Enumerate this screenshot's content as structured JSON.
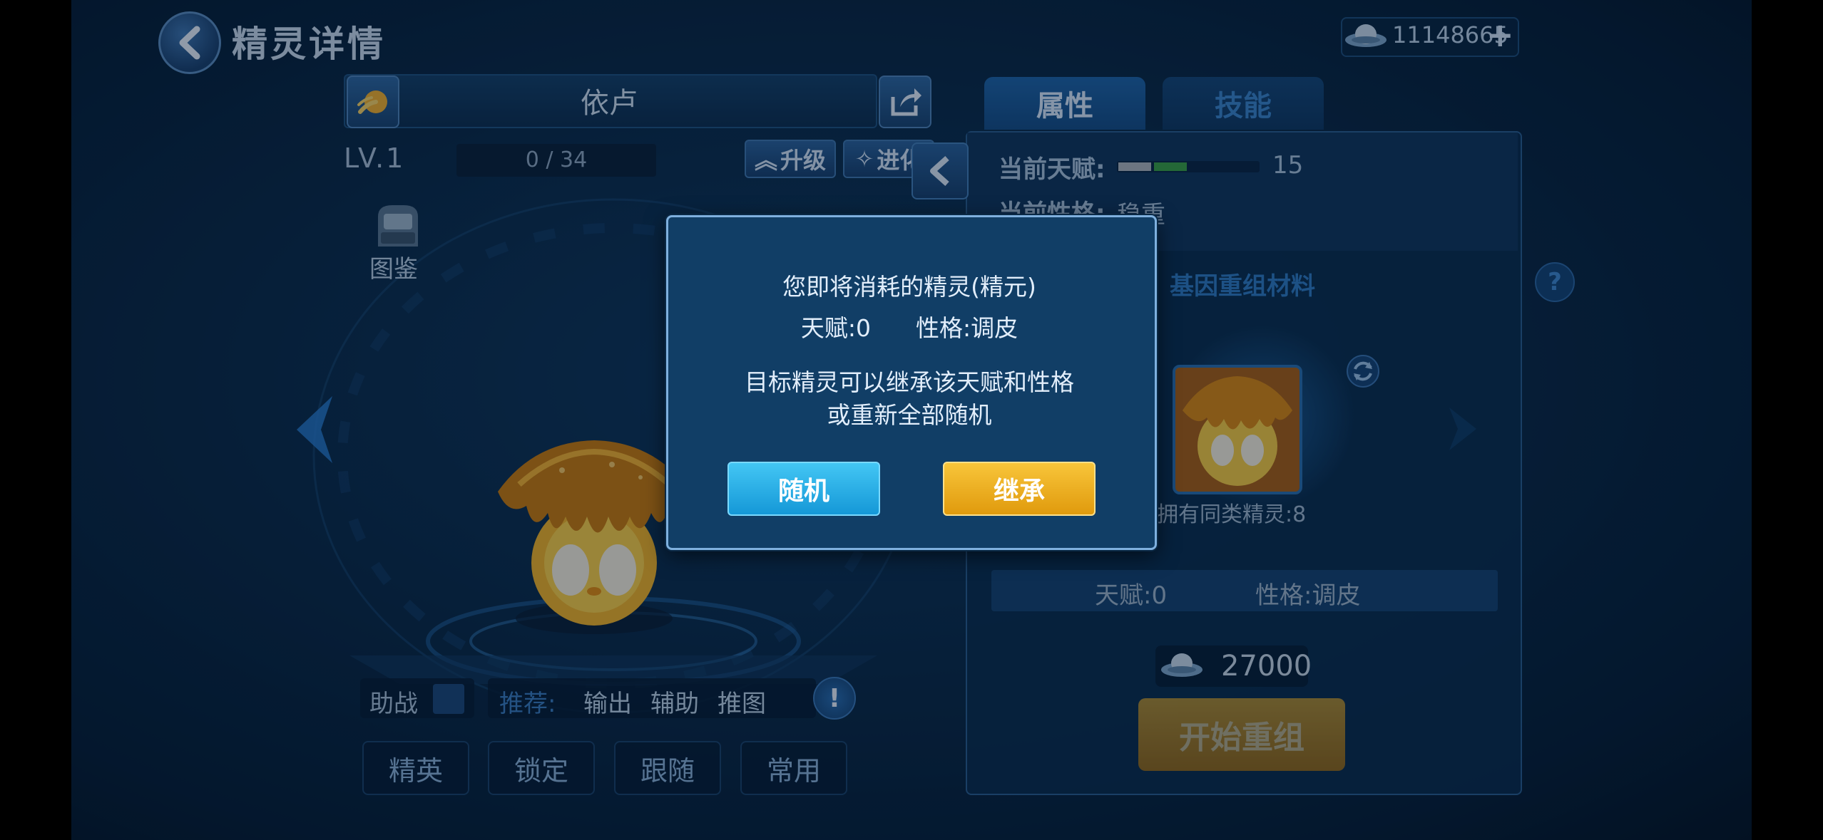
{
  "header": {
    "title": "精灵详情",
    "currency_value": "11148665",
    "currency_icon": "ufo-coin-icon",
    "plus_icon": "plus-icon"
  },
  "pet": {
    "name": "依卢",
    "level_label": "LV.1",
    "exp_text": "0 / 34",
    "upgrade_label": "升级",
    "evolve_label": "进化",
    "codex_label": "图鉴"
  },
  "left_bottom": {
    "assist_label": "助战",
    "recommend_label": "推荐:",
    "recommend_tags": [
      "输出",
      "辅助",
      "推图"
    ],
    "buttons": [
      "精英",
      "锁定",
      "跟随",
      "常用"
    ]
  },
  "tabs": {
    "attributes": "属性",
    "skills": "技能"
  },
  "right_panel": {
    "talent_label": "当前天赋:",
    "talent_value": "15",
    "nature_label": "当前性格:",
    "nature_value": "稳重",
    "gene_title": "基因重组材料",
    "help_icon_text": "?",
    "own_same_text": "拥有同类精灵:8",
    "stat_talent": "天赋:0",
    "stat_nature": "性格:调皮",
    "cost_value": "27000",
    "start_button": "开始重组"
  },
  "dialog": {
    "line1": "您即将消耗的精灵(精元)",
    "line2": "天赋:0      性格:调皮",
    "line3": "目标精灵可以继承该天赋和性格",
    "line4": "或重新全部随机",
    "random_button": "随机",
    "inherit_button": "继承"
  },
  "colors": {
    "accent_blue": "#2a7fd4",
    "inherit_gold": "#e09a0d",
    "random_cyan": "#1598d7"
  }
}
